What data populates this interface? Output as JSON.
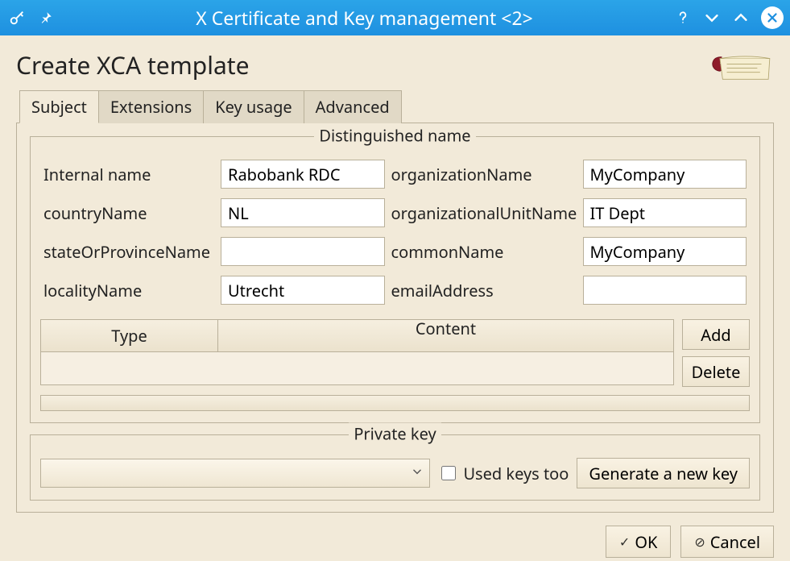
{
  "window": {
    "title": "X Certificate and Key management <2>"
  },
  "page": {
    "title": "Create XCA template"
  },
  "tabs": [
    {
      "id": "subject",
      "label": "Subject",
      "active": true
    },
    {
      "id": "extensions",
      "label": "Extensions",
      "active": false
    },
    {
      "id": "keyusage",
      "label": "Key usage",
      "active": false
    },
    {
      "id": "advanced",
      "label": "Advanced",
      "active": false
    }
  ],
  "distinguished_name": {
    "legend": "Distinguished name",
    "fields": {
      "internalName": {
        "label": "Internal name",
        "value": "Rabobank RDC"
      },
      "organizationName": {
        "label": "organizationName",
        "value": "MyCompany"
      },
      "countryName": {
        "label": "countryName",
        "value": "NL"
      },
      "organizationalUnitName": {
        "label": "organizationalUnitName",
        "value": "IT Dept"
      },
      "stateOrProvinceName": {
        "label": "stateOrProvinceName",
        "value": ""
      },
      "commonName": {
        "label": "commonName",
        "value": "MyCompany"
      },
      "localityName": {
        "label": "localityName",
        "value": "Utrecht"
      },
      "emailAddress": {
        "label": "emailAddress",
        "value": ""
      }
    },
    "table": {
      "columns": {
        "type": "Type",
        "content": "Content"
      },
      "rows": []
    },
    "buttons": {
      "add": "Add",
      "delete": "Delete"
    }
  },
  "private_key": {
    "legend": "Private key",
    "selected": "",
    "used_keys_too": {
      "label": "Used keys too",
      "checked": false
    },
    "generate_label": "Generate a new key"
  },
  "footer": {
    "ok": "OK",
    "cancel": "Cancel"
  }
}
